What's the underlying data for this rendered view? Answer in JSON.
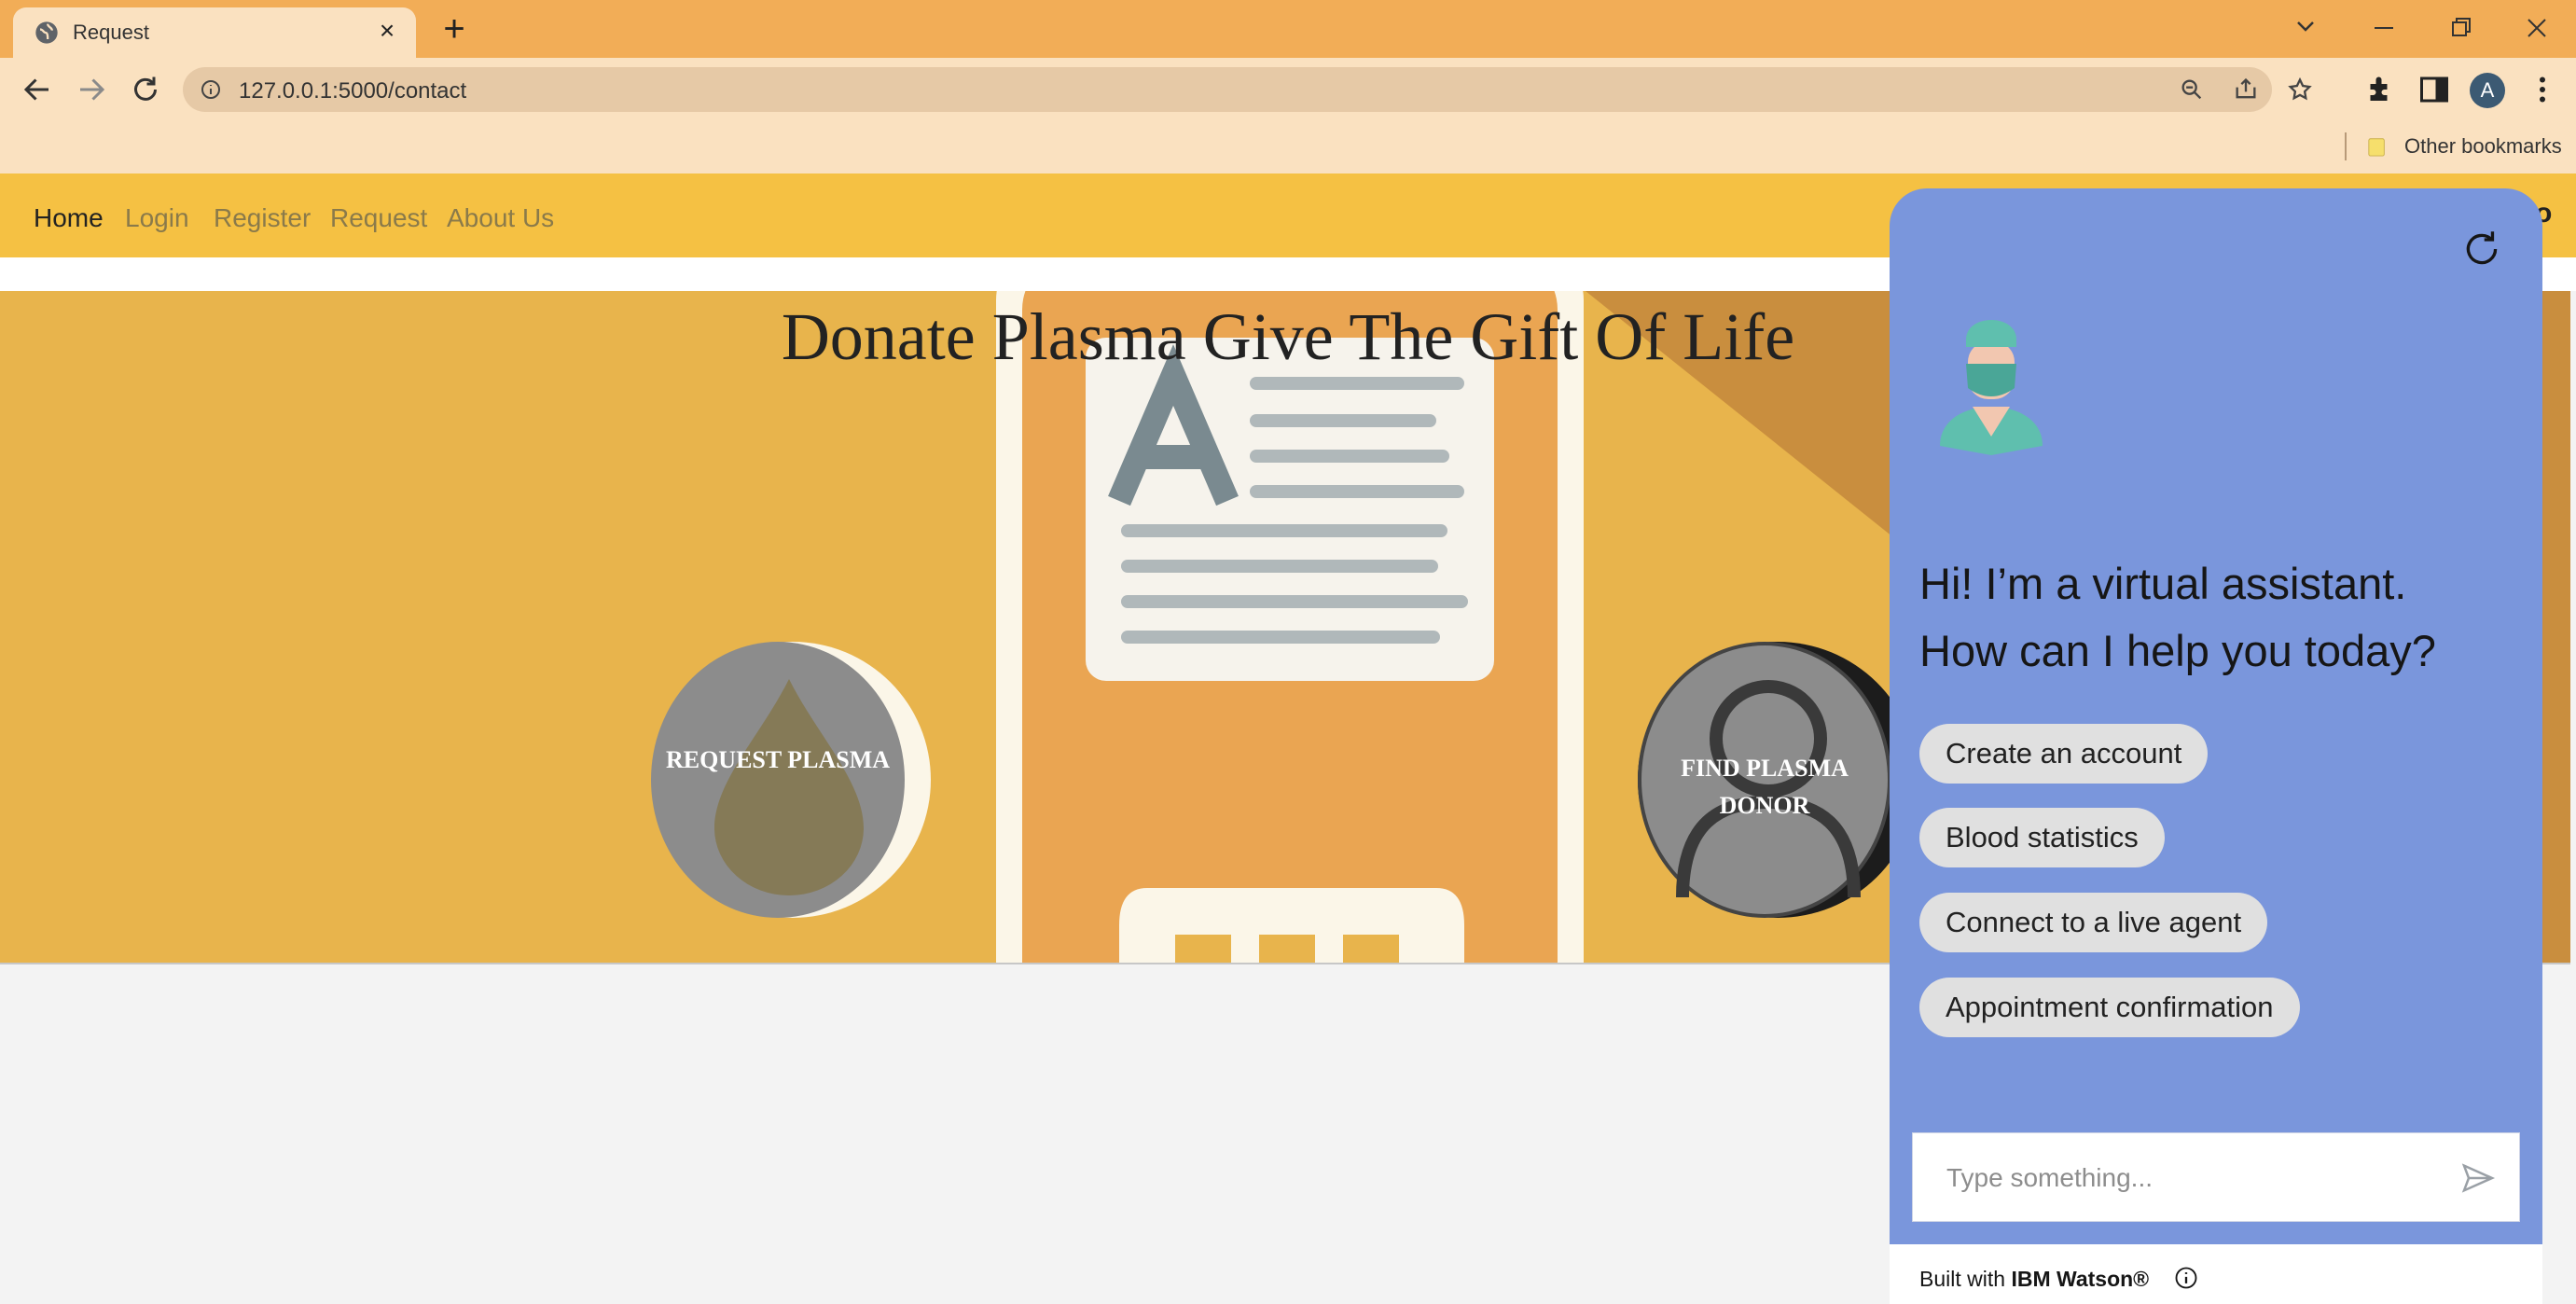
{
  "browser": {
    "tab_title": "Request",
    "url": "127.0.0.1:5000/contact",
    "bookmark": "Other bookmarks",
    "profile_initial": "A"
  },
  "navbar": {
    "items": [
      {
        "label": "Home"
      },
      {
        "label": "Login"
      },
      {
        "label": "Register"
      },
      {
        "label": "Request"
      },
      {
        "label": "About Us"
      }
    ],
    "right_fragment": "o"
  },
  "hero": {
    "title": "Donate Plasma Give The Gift Of Life",
    "request_button": "REQUEST PLASMA",
    "find_button_line1": "FIND PLASMA",
    "find_button_line2": "DONOR"
  },
  "chat": {
    "greeting_line1": "Hi! I’m a virtual assistant.",
    "greeting_line2": "How can I help you today?",
    "options": [
      {
        "label": "Create an account"
      },
      {
        "label": "Blood statistics"
      },
      {
        "label": "Connect to a live agent"
      },
      {
        "label": "Appointment confirmation"
      }
    ],
    "input_placeholder": "Type something...",
    "footer_prefix": "Built with",
    "footer_brand": "IBM Watson®"
  },
  "colors": {
    "tabbar": "#f2ad57",
    "toolbar": "#fae1c0",
    "navbar": "#f5c143",
    "hero": "#e8b44c",
    "chat_panel": "#7a96dc",
    "chip": "#e0e0e0"
  }
}
